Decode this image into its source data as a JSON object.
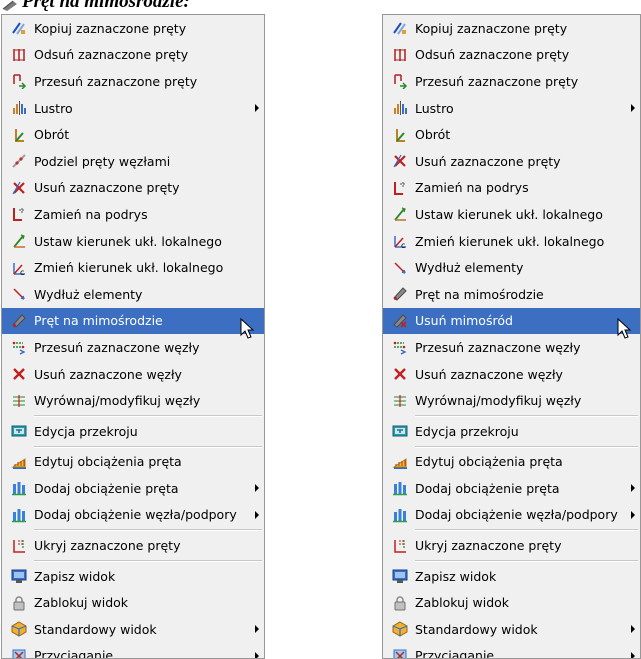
{
  "heading": {
    "title": "Pręt na mimośrodzie:"
  },
  "left_menu": {
    "items": [
      {
        "label": "Kopiuj zaznaczone pręty",
        "icon": "copy-bars-icon"
      },
      {
        "label": "Odsuń zaznaczone pręty",
        "icon": "offset-bars-icon"
      },
      {
        "label": "Przesuń zaznaczone pręty",
        "icon": "move-bars-icon"
      },
      {
        "label": "Lustro",
        "icon": "mirror-icon",
        "submenu": true
      },
      {
        "label": "Obrót",
        "icon": "rotate-icon"
      },
      {
        "label": "Podziel pręty węzłami",
        "icon": "split-bars-icon"
      },
      {
        "label": "Usuń zaznaczone pręty",
        "icon": "delete-bars-icon"
      },
      {
        "label": "Zamień na podrys",
        "icon": "convert-underlay-icon"
      },
      {
        "label": "Ustaw kierunek ukł. lokalnego",
        "icon": "set-local-axis-icon"
      },
      {
        "label": "Zmień kierunek ukł. lokalnego",
        "icon": "change-local-axis-icon"
      },
      {
        "label": "Wydłuż elementy",
        "icon": "extend-elements-icon"
      },
      {
        "label": "Pręt na mimośrodzie",
        "icon": "eccentric-bar-icon",
        "selected": true
      },
      {
        "label": "Przesuń zaznaczone węzły",
        "icon": "move-nodes-icon"
      },
      {
        "label": "Usuń zaznaczone węzły",
        "icon": "delete-nodes-icon"
      },
      {
        "label": "Wyrównaj/modyfikuj węzły",
        "icon": "align-nodes-icon"
      },
      {
        "label": "Edycja przekroju",
        "icon": "edit-section-icon"
      },
      {
        "label": "Edytuj obciążenia pręta",
        "icon": "edit-bar-loads-icon"
      },
      {
        "label": "Dodaj obciążenie pręta",
        "icon": "add-bar-load-icon",
        "submenu": true
      },
      {
        "label": "Dodaj obciążenie węzła/podpory",
        "icon": "add-node-load-icon",
        "submenu": true
      },
      {
        "label": "Ukryj zaznaczone pręty",
        "icon": "hide-bars-icon"
      },
      {
        "label": "Zapisz widok",
        "icon": "save-view-icon"
      },
      {
        "label": "Zablokuj widok",
        "icon": "lock-view-icon"
      },
      {
        "label": "Standardowy widok",
        "icon": "standard-view-icon",
        "submenu": true
      },
      {
        "label": "Przyciąganie",
        "icon": "snap-icon",
        "submenu": true
      }
    ]
  },
  "right_menu": {
    "items": [
      {
        "label": "Kopiuj zaznaczone pręty",
        "icon": "copy-bars-icon"
      },
      {
        "label": "Odsuń zaznaczone pręty",
        "icon": "offset-bars-icon"
      },
      {
        "label": "Przesuń zaznaczone pręty",
        "icon": "move-bars-icon"
      },
      {
        "label": "Lustro",
        "icon": "mirror-icon",
        "submenu": true
      },
      {
        "label": "Obrót",
        "icon": "rotate-icon"
      },
      {
        "label": "Usuń zaznaczone pręty",
        "icon": "delete-bars-icon"
      },
      {
        "label": "Zamień na podrys",
        "icon": "convert-underlay-icon"
      },
      {
        "label": "Ustaw kierunek ukł. lokalnego",
        "icon": "set-local-axis-icon"
      },
      {
        "label": "Zmień kierunek ukł. lokalnego",
        "icon": "change-local-axis-icon"
      },
      {
        "label": "Wydłuż elementy",
        "icon": "extend-elements-icon"
      },
      {
        "label": "Pręt na mimośrodzie",
        "icon": "eccentric-bar-icon"
      },
      {
        "label": "Usuń mimośród",
        "icon": "remove-eccentricity-icon",
        "selected": true
      },
      {
        "label": "Przesuń zaznaczone węzły",
        "icon": "move-nodes-icon"
      },
      {
        "label": "Usuń zaznaczone węzły",
        "icon": "delete-nodes-icon"
      },
      {
        "label": "Wyrównaj/modyfikuj węzły",
        "icon": "align-nodes-icon"
      },
      {
        "label": "Edycja przekroju",
        "icon": "edit-section-icon"
      },
      {
        "label": "Edytuj obciążenia pręta",
        "icon": "edit-bar-loads-icon"
      },
      {
        "label": "Dodaj obciążenie pręta",
        "icon": "add-bar-load-icon",
        "submenu": true
      },
      {
        "label": "Dodaj obciążenie węzła/podpory",
        "icon": "add-node-load-icon",
        "submenu": true
      },
      {
        "label": "Ukryj zaznaczone pręty",
        "icon": "hide-bars-icon"
      },
      {
        "label": "Zapisz widok",
        "icon": "save-view-icon"
      },
      {
        "label": "Zablokuj widok",
        "icon": "lock-view-icon"
      },
      {
        "label": "Standardowy widok",
        "icon": "standard-view-icon",
        "submenu": true
      },
      {
        "label": "Przyciąganie",
        "icon": "snap-icon",
        "submenu": true
      }
    ]
  },
  "colors": {
    "menu_bg": "#f0f0f0",
    "selection": "#3c6fc2",
    "border": "#979797"
  }
}
